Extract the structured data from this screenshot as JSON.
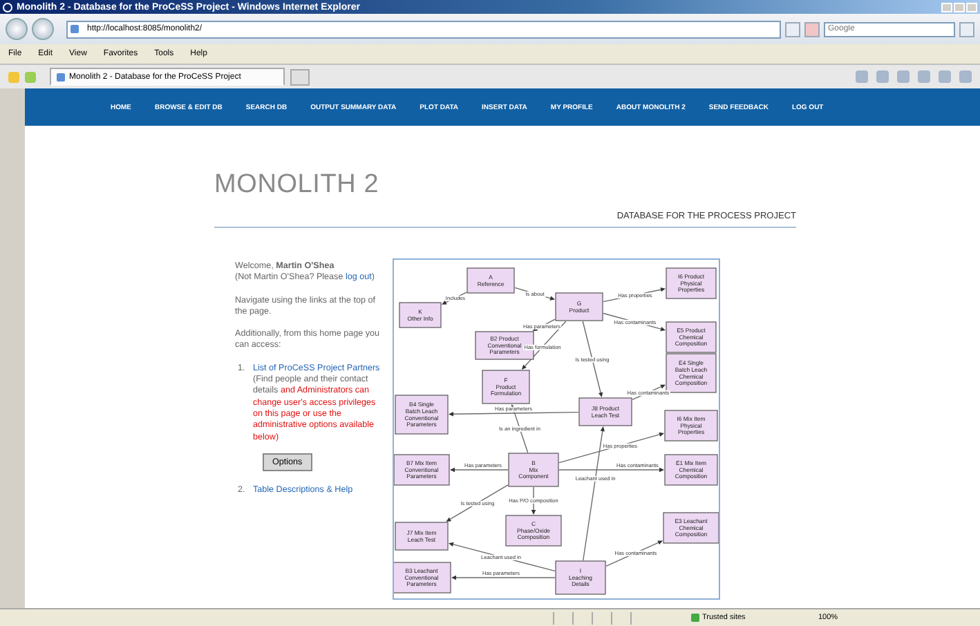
{
  "window": {
    "title": "Monolith 2 - Database for the ProCeSS Project - Windows Internet Explorer"
  },
  "address_bar": {
    "value": "http://localhost:8085/monolith2/"
  },
  "search": {
    "placeholder": "Google"
  },
  "menu": [
    "File",
    "Edit",
    "View",
    "Favorites",
    "Tools",
    "Help"
  ],
  "tabs": [
    {
      "label": "Monolith 2 - Database for the ProCeSS Project",
      "selected": true
    }
  ],
  "nav": [
    "HOME",
    "BROWSE & EDIT DB",
    "SEARCH DB",
    "OUTPUT SUMMARY DATA",
    "PLOT DATA",
    "INSERT DATA",
    "MY PROFILE",
    "ABOUT MONOLITH 2",
    "SEND FEEDBACK",
    "LOG OUT"
  ],
  "site": {
    "title": "MONOLITH 2",
    "subtitle": "DATABASE FOR THE PROCESS PROJECT"
  },
  "welcome": {
    "text": "Welcome, **Martin O'Shea**",
    "prompt": "(Not Martin O'Shea? Please",
    "link": "log out",
    "close": ")"
  },
  "paragraphs": [
    "Navigate using the links at the top of the page.",
    "Additionally, from this home page you can access:"
  ],
  "list": [
    {
      "number": "1.",
      "link": "List of ProCeSS Project Partners",
      "note": "(Find people and their contact details",
      "admin_note": "and Administrators can change user's access privileges on this page or use the administrative options available below)",
      "button": "Options"
    },
    {
      "number": "2.",
      "link": "Table Descriptions & Help"
    }
  ],
  "diagram": {
    "nodes": [
      {
        "lines": [
          "A",
          "Reference"
        ]
      },
      {
        "lines": [
          "K",
          "Other Info"
        ]
      },
      {
        "lines": [
          "G",
          "Product"
        ]
      },
      {
        "lines": [
          "I6 Product",
          "Physical",
          "Properties"
        ]
      },
      {
        "lines": [
          "B2 Product",
          "Conventional",
          "Parameters"
        ]
      },
      {
        "lines": [
          "E5 Product",
          "Chemical",
          "Composition"
        ]
      },
      {
        "lines": [
          "F",
          "Product",
          "Formulation"
        ]
      },
      {
        "lines": [
          "E4 Single",
          "Batch Leach",
          "Chemical",
          "Composition"
        ]
      },
      {
        "lines": [
          "B4 Single",
          "Batch Leach",
          "Conventional",
          "Parameters"
        ]
      },
      {
        "lines": [
          "J8 Product",
          "Leach Test"
        ]
      },
      {
        "lines": [
          "I6 Mix Item",
          "Physical",
          "Properties"
        ]
      },
      {
        "lines": [
          "B7 Mix Item",
          "Conventional",
          "Parameters"
        ]
      },
      {
        "lines": [
          "B",
          "Mix",
          "Component"
        ]
      },
      {
        "lines": [
          "E1 Mix Item",
          "Chemical",
          "Composition"
        ]
      },
      {
        "lines": [
          "J7 Mix Item",
          "Leach Test"
        ]
      },
      {
        "lines": [
          "C",
          "Phase/Oxide",
          "Composition"
        ]
      },
      {
        "lines": [
          "E3 Leachant",
          "Chemical",
          "Composition"
        ]
      },
      {
        "lines": [
          "B3 Leachant",
          "Conventional",
          "Parameters"
        ]
      },
      {
        "lines": [
          "I",
          "Leaching",
          "Details"
        ]
      }
    ],
    "relations": [
      "Includes",
      "Is about",
      "Has properties",
      "Has parameters",
      "Has formulation",
      "Has contaminants",
      "Is tested using",
      "Has contaminants",
      "Has parameters",
      "Is an ingredient in",
      "Has properties",
      "Has parameters",
      "Has contaminants",
      "Is tested using",
      "Has P/O composition",
      "Leachant used in",
      "Leachant used in",
      "Has contaminants",
      "Has parameters"
    ]
  },
  "status_bar": {
    "zone": "Trusted sites",
    "zoom": "100%"
  }
}
